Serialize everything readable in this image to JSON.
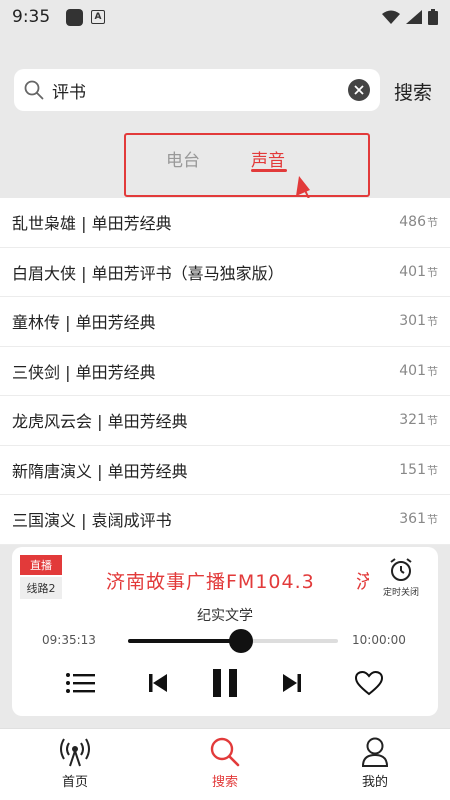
{
  "status_bar": {
    "time": "9:35"
  },
  "search": {
    "query": "评书",
    "button_label": "搜索"
  },
  "tabs": [
    {
      "label": "电台",
      "active": false
    },
    {
      "label": "声音",
      "active": true
    }
  ],
  "results": [
    {
      "title": "乱世枭雄 | 单田芳经典",
      "count": "486",
      "unit": "节"
    },
    {
      "title": "白眉大侠 | 单田芳评书（喜马独家版）",
      "count": "401",
      "unit": "节"
    },
    {
      "title": "童林传 | 单田芳经典",
      "count": "301",
      "unit": "节"
    },
    {
      "title": "三侠剑 | 单田芳经典",
      "count": "401",
      "unit": "节"
    },
    {
      "title": "龙虎风云会 | 单田芳经典",
      "count": "321",
      "unit": "节"
    },
    {
      "title": "新隋唐演义 | 单田芳经典",
      "count": "151",
      "unit": "节"
    },
    {
      "title": "三国演义 | 袁阔成评书",
      "count": "361",
      "unit": "节"
    }
  ],
  "player": {
    "live_label": "直播",
    "line_label": "线路2",
    "station": "济南故事广播FM104.3",
    "marquee_tail": "济",
    "timer_label": "定时关闭",
    "program": "纪实文学",
    "current_time": "09:35:13",
    "end_time": "10:00:00",
    "progress": 0.54
  },
  "bottom_nav": [
    {
      "label": "首页",
      "icon": "radio-tower-icon",
      "active": false
    },
    {
      "label": "搜索",
      "icon": "search-icon",
      "active": true
    },
    {
      "label": "我的",
      "icon": "user-icon",
      "active": false
    }
  ],
  "colors": {
    "accent": "#e23a3a",
    "background": "#e9e9e9"
  }
}
